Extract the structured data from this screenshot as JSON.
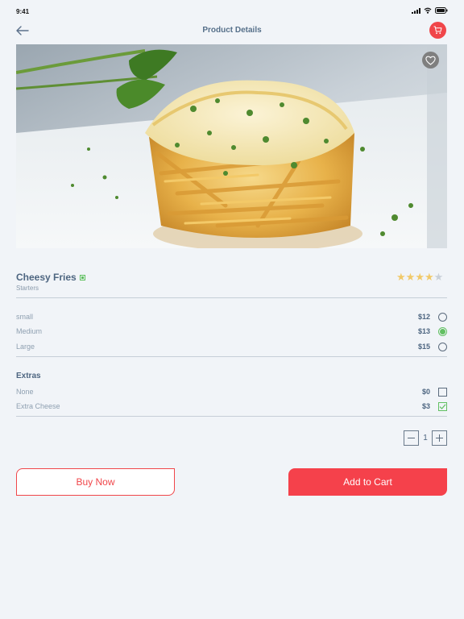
{
  "status": {
    "time": "9:41"
  },
  "header": {
    "title": "Product Details"
  },
  "product": {
    "name": "Cheesy Fries",
    "category": "Starters",
    "rating": 4,
    "rating_max": 5
  },
  "sizes": [
    {
      "label": "small",
      "price": "$12",
      "selected": false
    },
    {
      "label": "Medium",
      "price": "$13",
      "selected": true
    },
    {
      "label": "Large",
      "price": "$15",
      "selected": false
    }
  ],
  "extras": {
    "title": "Extras",
    "items": [
      {
        "label": "None",
        "price": "$0",
        "checked": false
      },
      {
        "label": "Extra Cheese",
        "price": "$3",
        "checked": true
      }
    ]
  },
  "quantity": {
    "value": "1"
  },
  "actions": {
    "buy_label": "Buy Now",
    "add_label": "Add to Cart"
  },
  "colors": {
    "accent": "#f0464a",
    "selected": "#62c062",
    "star": "#f1c969"
  }
}
